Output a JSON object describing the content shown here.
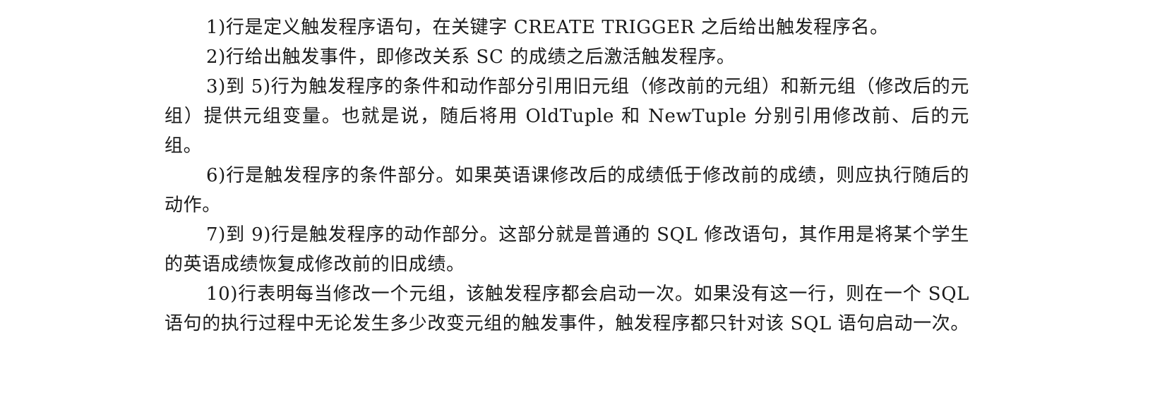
{
  "document": {
    "paragraphs": [
      "1)行是定义触发程序语句，在关键字 CREATE TRIGGER 之后给出触发程序名。",
      "2)行给出触发事件，即修改关系 SC 的成绩之后激活触发程序。",
      "3)到 5)行为触发程序的条件和动作部分引用旧元组（修改前的元组）和新元组（修改后的元组）提供元组变量。也就是说，随后将用 OldTuple 和 NewTuple 分别引用修改前、后的元组。",
      "6)行是触发程序的条件部分。如果英语课修改后的成绩低于修改前的成绩，则应执行随后的动作。",
      "7)到 9)行是触发程序的动作部分。这部分就是普通的 SQL 修改语句，其作用是将某个学生的英语成绩恢复成修改前的旧成绩。",
      "10)行表明每当修改一个元组，该触发程序都会启动一次。如果没有这一行，则在一个 SQL 语句的执行过程中无论发生多少改变元组的触发事件，触发程序都只针对该 SQL 语句启动一次。"
    ]
  }
}
